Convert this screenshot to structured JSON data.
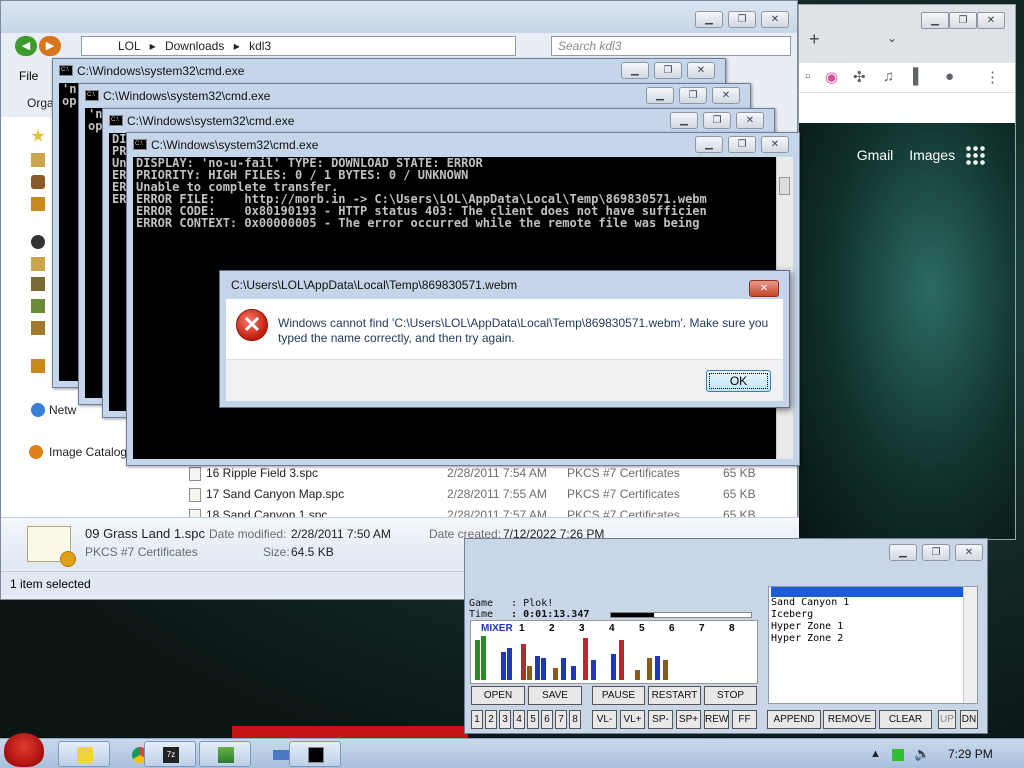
{
  "chrome": {
    "gmail": "Gmail",
    "images": "Images"
  },
  "explorer": {
    "path": [
      "LOL",
      "Downloads",
      "kdl3"
    ],
    "search_placeholder": "Search kdl3",
    "menu_file": "File",
    "organize": "Orga",
    "sidebar": {
      "network": "Netw",
      "image_catalog": "Image Catalog"
    },
    "files": [
      {
        "name": "16 Ripple Field 3.spc",
        "date": "2/28/2011 7:54 AM",
        "type": "PKCS #7 Certificates",
        "size": "65 KB"
      },
      {
        "name": "17 Sand Canyon Map.spc",
        "date": "2/28/2011 7:55 AM",
        "type": "PKCS #7 Certificates",
        "size": "65 KB"
      },
      {
        "name": "18 Sand Canyon 1.spc",
        "date": "2/28/2011 7:57 AM",
        "type": "PKCS #7 Certificates",
        "size": "65 KB"
      }
    ],
    "details": {
      "name": "09 Grass Land 1.spc",
      "modified_label": "Date modified:",
      "modified": "2/28/2011 7:50 AM",
      "created_label": "Date created:",
      "created": "7/12/2022 7:26 PM",
      "type": "PKCS #7 Certificates",
      "size_label": "Size:",
      "size": "64.5 KB"
    },
    "status": "1 item selected"
  },
  "cmd": {
    "title": "C:\\Windows\\system32\\cmd.exe",
    "back_lines_1": "'n\nop",
    "back_lines_2": "'n\nop",
    "back_lines_3": "DI\nPR\nUn\nER\nER\nER",
    "lines": [
      "DISPLAY: 'no-u-fail' TYPE: DOWNLOAD STATE: ERROR",
      "PRIORITY: HIGH FILES: 0 / 1 BYTES: 0 / UNKNOWN",
      "Unable to complete transfer.",
      "ERROR FILE:    http://morb.in -> C:\\Users\\LOL\\AppData\\Local\\Temp\\869830571.webm",
      "ERROR CODE:    0x80190193 - HTTP status 403: The client does not have sufficien",
      "ERROR CONTEXT: 0x00000005 - The error occurred while the remote file was being"
    ]
  },
  "dialog": {
    "title": "C:\\Users\\LOL\\AppData\\Local\\Temp\\869830571.webm",
    "message": "Windows cannot find 'C:\\Users\\LOL\\AppData\\Local\\Temp\\869830571.webm'. Make sure you typed the name correctly, and then try again.",
    "ok": "OK"
  },
  "player": {
    "game_label": "Game",
    "game": ": Plok!",
    "time_label": "Time",
    "time": ": 0:01:13.347",
    "time_progress": 0.31,
    "mixer_label": "MIXER",
    "channels": [
      "1",
      "2",
      "3",
      "4",
      "5",
      "6",
      "7",
      "8"
    ],
    "playlist": [
      "Sand Canyon 1",
      "Iceberg",
      "Hyper Zone 1",
      "Hyper Zone 2"
    ],
    "buttons": {
      "open": "OPEN",
      "save": "SAVE",
      "pause": "PAUSE",
      "restart": "RESTART",
      "stop": "STOP",
      "vl_minus": "VL-",
      "vl_plus": "VL+",
      "sp_minus": "SP-",
      "sp_plus": "SP+",
      "rew": "REW",
      "ff": "FF",
      "append": "APPEND",
      "remove": "REMOVE",
      "clear": "CLEAR",
      "up": "UP",
      "dn": "DN"
    },
    "channel_toggles": [
      "1",
      "2",
      "3",
      "4",
      "5",
      "6",
      "7",
      "8"
    ]
  },
  "taskbar": {
    "clock": "7:29 PM"
  }
}
